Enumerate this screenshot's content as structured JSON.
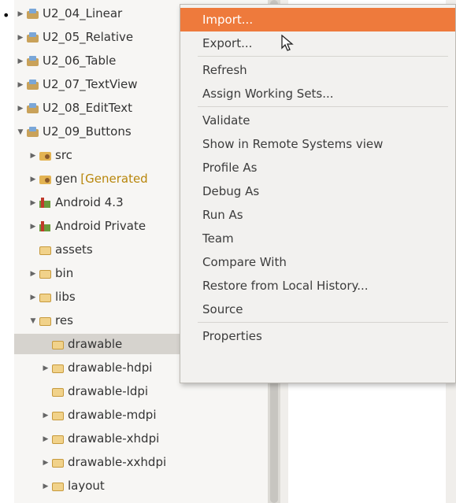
{
  "tree": {
    "items": [
      {
        "arrow": "right",
        "icon": "project-icon",
        "label": "U2_04_Linear"
      },
      {
        "arrow": "right",
        "icon": "project-icon",
        "label": "U2_05_Relative"
      },
      {
        "arrow": "right",
        "icon": "project-icon",
        "label": "U2_06_Table"
      },
      {
        "arrow": "right",
        "icon": "project-icon",
        "label": "U2_07_TextView"
      },
      {
        "arrow": "right",
        "icon": "project-icon",
        "label": "U2_08_EditText"
      },
      {
        "arrow": "down",
        "icon": "project-icon",
        "label": "U2_09_Buttons"
      },
      {
        "arrow": "right",
        "icon": "src-folder-icon",
        "label": "src"
      },
      {
        "arrow": "right",
        "icon": "src-folder-icon",
        "label": "gen",
        "note": "[Generated"
      },
      {
        "arrow": "right",
        "icon": "library-icon",
        "label": "Android 4.3"
      },
      {
        "arrow": "right",
        "icon": "library-icon",
        "label": "Android Private"
      },
      {
        "arrow": "none",
        "icon": "folder-icon",
        "label": "assets"
      },
      {
        "arrow": "right",
        "icon": "folder-icon",
        "label": "bin"
      },
      {
        "arrow": "right",
        "icon": "folder-icon",
        "label": "libs"
      },
      {
        "arrow": "down",
        "icon": "folder-icon",
        "label": "res"
      },
      {
        "arrow": "none",
        "icon": "folder-icon",
        "label": "drawable",
        "selected": true
      },
      {
        "arrow": "right",
        "icon": "folder-icon",
        "label": "drawable-hdpi"
      },
      {
        "arrow": "none",
        "icon": "folder-icon",
        "label": "drawable-ldpi"
      },
      {
        "arrow": "right",
        "icon": "folder-icon",
        "label": "drawable-mdpi"
      },
      {
        "arrow": "right",
        "icon": "folder-icon",
        "label": "drawable-xhdpi"
      },
      {
        "arrow": "right",
        "icon": "folder-icon",
        "label": "drawable-xxhdpi"
      },
      {
        "arrow": "right",
        "icon": "folder-icon",
        "label": "layout"
      }
    ]
  },
  "context_menu": {
    "items": [
      {
        "label": "Import...",
        "highlighted": true
      },
      {
        "label": "Export..."
      },
      {
        "separator": true
      },
      {
        "label": "Refresh"
      },
      {
        "label": "Assign Working Sets..."
      },
      {
        "separator": true
      },
      {
        "label": "Validate"
      },
      {
        "label": "Show in Remote Systems view"
      },
      {
        "label": "Profile As"
      },
      {
        "label": "Debug As"
      },
      {
        "label": "Run As"
      },
      {
        "label": "Team"
      },
      {
        "label": "Compare With"
      },
      {
        "label": "Restore from Local History..."
      },
      {
        "label": "Source"
      },
      {
        "separator": true
      },
      {
        "label": "Properties"
      }
    ]
  },
  "colors": {
    "menu_highlight": "#ee7a3c",
    "selection": "#d6d3ce"
  },
  "bullet": "•"
}
